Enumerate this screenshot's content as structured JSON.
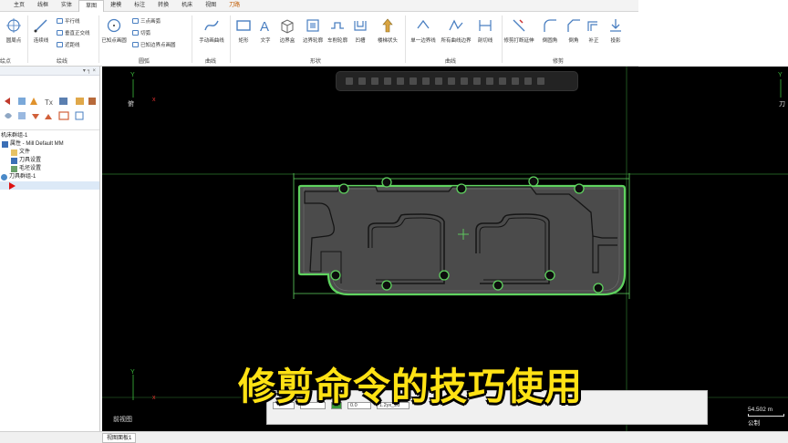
{
  "tabs": [
    {
      "label": "主页"
    },
    {
      "label": "线框"
    },
    {
      "label": "实体"
    },
    {
      "label": "草图",
      "active": true
    },
    {
      "label": "建模"
    },
    {
      "label": "标注"
    },
    {
      "label": "转换"
    },
    {
      "label": "机床"
    },
    {
      "label": "视图"
    },
    {
      "label": "刀路",
      "accent": true
    }
  ],
  "ribbon": {
    "points_btn": "圆周点",
    "line_btn": "连续线",
    "parallel": "平行线",
    "perpendicular": "垂直正交线",
    "near_line": "近距线",
    "arc_center": "已知点画圆",
    "three_point": "三点画弧",
    "tangent_arc": "切弧",
    "edge_point": "已知边界点画圆",
    "manual_spline": "手动画曲线",
    "rect": "矩形",
    "text": "文字",
    "bounding_box": "边界盒",
    "boundary_profile": "边界轮廓",
    "lathe_profile": "车削轮廓",
    "groove": "凹槽",
    "stair": "楼梯状头",
    "single_boundary": "单一边界线",
    "all_boundary": "所有曲线边界",
    "cut_line": "剖切线",
    "trim_extend": "修剪打断延伸",
    "fillet": "倒圆角",
    "chamfer": "倒角",
    "compensate": "补正",
    "project": "投影",
    "groups": {
      "points": "绘点",
      "lines": "绘线",
      "arcs": "圆弧",
      "curves": "曲线",
      "shapes": "形状",
      "curve2": "曲线",
      "modify": "修剪"
    }
  },
  "leftpanel": {
    "header": "▾ ╕ ×",
    "tree": [
      {
        "label": "机床群组-1",
        "indent": 0
      },
      {
        "label": "属性 - Mill Default MM",
        "indent": 1
      },
      {
        "label": "文件",
        "indent": 2
      },
      {
        "label": "刀具设置",
        "indent": 2
      },
      {
        "label": "毛坯设置",
        "indent": 2
      },
      {
        "label": "刀具群组-1",
        "indent": 0
      },
      {
        "label": "",
        "indent": 1,
        "selected": true
      }
    ]
  },
  "canvas": {
    "view_top": "俯",
    "view_front": "前视图",
    "axis_y": "Y",
    "axis_x": "X",
    "right_view_label": "刀",
    "scale_value": "54.502 m",
    "scale_unit": "公制"
  },
  "bottom_bar": {
    "fields": [
      "0.0",
      "1.2yx_2d"
    ]
  },
  "caption": "修剪命令的技巧使用",
  "statusbar": {
    "tab": "视图面板1"
  },
  "colors": {
    "geometry": "#5fd35f",
    "part_fill": "#4a4a4a",
    "caption": "#ffe214",
    "canvas_bg": "#000000"
  }
}
